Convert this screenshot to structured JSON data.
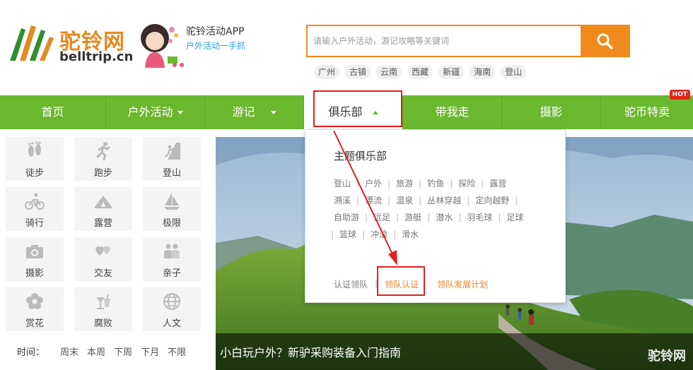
{
  "header": {
    "logo_cn": "驼铃网",
    "logo_en": "belltrip.cn",
    "app_title": "驼铃活动APP",
    "app_subtitle": "户外活动一手抓"
  },
  "search": {
    "placeholder": "请输入户外活动，游记攻略等关键词",
    "hot_tags": [
      "广州",
      "古镇",
      "云南",
      "西藏",
      "新疆",
      "海南",
      "登山"
    ]
  },
  "nav": {
    "items": [
      {
        "label": "首页"
      },
      {
        "label": "户外活动"
      },
      {
        "label": "游记"
      },
      {
        "label": "俱乐部"
      },
      {
        "label": "带我走"
      },
      {
        "label": "摄影"
      },
      {
        "label": "驼币特卖"
      }
    ],
    "hot_badge": "HOT"
  },
  "categories": [
    {
      "label": "徒步",
      "icon": "footprints-icon"
    },
    {
      "label": "跑步",
      "icon": "runner-icon"
    },
    {
      "label": "登山",
      "icon": "climber-icon"
    },
    {
      "label": "骑行",
      "icon": "bicycle-icon"
    },
    {
      "label": "露营",
      "icon": "tent-icon"
    },
    {
      "label": "极限",
      "icon": "sailboat-icon"
    },
    {
      "label": "摄影",
      "icon": "camera-icon"
    },
    {
      "label": "交友",
      "icon": "hearts-icon"
    },
    {
      "label": "亲子",
      "icon": "family-icon"
    },
    {
      "label": "赏花",
      "icon": "flower-icon"
    },
    {
      "label": "腐败",
      "icon": "cocktail-icon"
    },
    {
      "label": "人文",
      "icon": "globe-icon"
    }
  ],
  "time_filter": {
    "label": "时间：",
    "options": [
      "周末",
      "本周",
      "下周",
      "下月",
      "不限"
    ]
  },
  "banner": {
    "title": "小白玩户外？新驴采购装备入门指南",
    "watermark": "驼铃网"
  },
  "dropdown": {
    "title": "主题俱乐部",
    "rows": [
      [
        "登山",
        "户外",
        "旅游",
        "钓鱼",
        "探险",
        "露营"
      ],
      [
        "溯溪",
        "漂流",
        "温泉",
        "丛林穿越",
        "定向越野",
        ""
      ],
      [
        "自助游",
        "远足",
        "游艇",
        "潜水",
        "羽毛球",
        "足球"
      ],
      [
        "",
        "篮球",
        "冲浪",
        "滑水"
      ]
    ],
    "footer": {
      "link1": "认证领队",
      "link2": "领队认证",
      "link3": "领队发展计划"
    }
  },
  "colors": {
    "nav_green": "#6ab82e",
    "accent_orange": "#f08a1c",
    "annotation_red": "#e02020"
  }
}
